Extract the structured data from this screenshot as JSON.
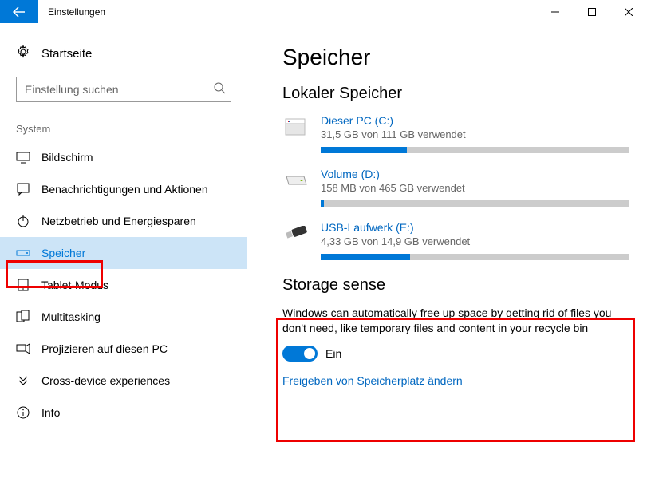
{
  "window": {
    "title": "Einstellungen"
  },
  "sidebar": {
    "home": "Startseite",
    "search_placeholder": "Einstellung suchen",
    "group": "System",
    "items": [
      {
        "label": "Bildschirm"
      },
      {
        "label": "Benachrichtigungen und Aktionen"
      },
      {
        "label": "Netzbetrieb und Energiesparen"
      },
      {
        "label": "Speicher"
      },
      {
        "label": "Tablet-Modus"
      },
      {
        "label": "Multitasking"
      },
      {
        "label": "Projizieren auf diesen PC"
      },
      {
        "label": "Cross-device experiences"
      },
      {
        "label": "Info"
      }
    ]
  },
  "main": {
    "heading": "Speicher",
    "local_heading": "Lokaler Speicher",
    "drives": [
      {
        "name": "Dieser PC (C:)",
        "sub": "31,5 GB von 111 GB verwendet",
        "pct": 28
      },
      {
        "name": "Volume (D:)",
        "sub": "158 MB von 465 GB verwendet",
        "pct": 1
      },
      {
        "name": "USB-Laufwerk (E:)",
        "sub": "4,33 GB von 14,9 GB verwendet",
        "pct": 29
      }
    ],
    "sense": {
      "heading": "Storage sense",
      "desc": "Windows can automatically free up space by getting rid of files you don't need, like temporary files and content in your recycle bin",
      "toggle_label": "Ein"
    },
    "link": "Freigeben von Speicherplatz ändern"
  }
}
